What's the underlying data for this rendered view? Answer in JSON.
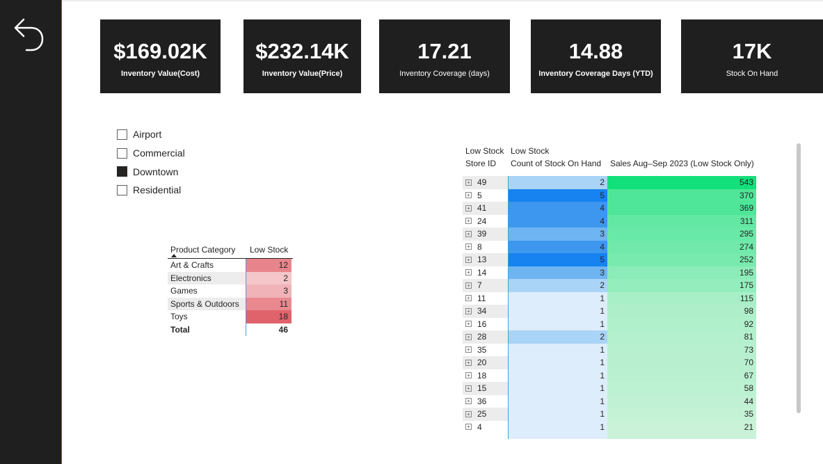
{
  "nav": {
    "back_icon": "undo-arrow-icon"
  },
  "kpis": [
    {
      "value": "$169.02K",
      "label": "Inventory Value(Cost)"
    },
    {
      "value": "$232.14K",
      "label": "Inventory Value(Price)"
    },
    {
      "value": "17.21",
      "label": "Inventory Coverage (days)"
    },
    {
      "value": "14.88",
      "label": "Inventory Coverage Days (YTD)"
    },
    {
      "value": "17K",
      "label": "Stock On Hand"
    }
  ],
  "slicer": {
    "items": [
      {
        "label": "Airport",
        "checked": false
      },
      {
        "label": "Commercial",
        "checked": false
      },
      {
        "label": "Downtown",
        "checked": true
      },
      {
        "label": "Residential",
        "checked": false
      }
    ]
  },
  "category_table": {
    "headers": [
      "Product Category",
      "Low Stock"
    ],
    "rows": [
      {
        "category": "Art & Crafts",
        "low_stock": "12"
      },
      {
        "category": "Electronics",
        "low_stock": "2"
      },
      {
        "category": "Games",
        "low_stock": "3"
      },
      {
        "category": "Sports & Outdoors",
        "low_stock": "11"
      },
      {
        "category": "Toys",
        "low_stock": "18"
      }
    ],
    "total_label": "Total",
    "total_value": "46",
    "heat_colors": {
      "2": "#f4c6c9",
      "3": "#f0b3b7",
      "11": "#e9888f",
      "12": "#e8858c",
      "18": "#e0636c"
    }
  },
  "store_table": {
    "headers": [
      "Low Stock\nStore ID",
      "Low Stock\nCount of Stock On Hand",
      "Sales Aug–Sep 2023 (Low Stock Only)"
    ],
    "rows": [
      {
        "store_id": "49",
        "count": "2",
        "sales": "543"
      },
      {
        "store_id": "5",
        "count": "5",
        "sales": "370"
      },
      {
        "store_id": "41",
        "count": "4",
        "sales": "369"
      },
      {
        "store_id": "24",
        "count": "4",
        "sales": "311"
      },
      {
        "store_id": "39",
        "count": "3",
        "sales": "295"
      },
      {
        "store_id": "8",
        "count": "4",
        "sales": "274"
      },
      {
        "store_id": "13",
        "count": "5",
        "sales": "252"
      },
      {
        "store_id": "14",
        "count": "3",
        "sales": "195"
      },
      {
        "store_id": "7",
        "count": "2",
        "sales": "175"
      },
      {
        "store_id": "11",
        "count": "1",
        "sales": "115"
      },
      {
        "store_id": "34",
        "count": "1",
        "sales": "98"
      },
      {
        "store_id": "16",
        "count": "1",
        "sales": "92"
      },
      {
        "store_id": "28",
        "count": "2",
        "sales": "81"
      },
      {
        "store_id": "35",
        "count": "1",
        "sales": "73"
      },
      {
        "store_id": "20",
        "count": "1",
        "sales": "70"
      },
      {
        "store_id": "18",
        "count": "1",
        "sales": "67"
      },
      {
        "store_id": "15",
        "count": "1",
        "sales": "58"
      },
      {
        "store_id": "36",
        "count": "1",
        "sales": "44"
      },
      {
        "store_id": "25",
        "count": "1",
        "sales": "35"
      },
      {
        "store_id": "4",
        "count": "1",
        "sales": "21"
      }
    ],
    "count_colors": {
      "1": "#deedfb",
      "2": "#a9d3f7",
      "3": "#6fb4f2",
      "4": "#3d97ee",
      "5": "#1683f0"
    },
    "sales_color_max": "#12e07a",
    "sales_color_min": "#c9f2d8",
    "expand_icon": "plus-square-icon"
  },
  "colors": {
    "card_bg": "#1f1f1f",
    "rail_bg": "#1f1f1f",
    "rail_border": "#3b6e9a"
  }
}
